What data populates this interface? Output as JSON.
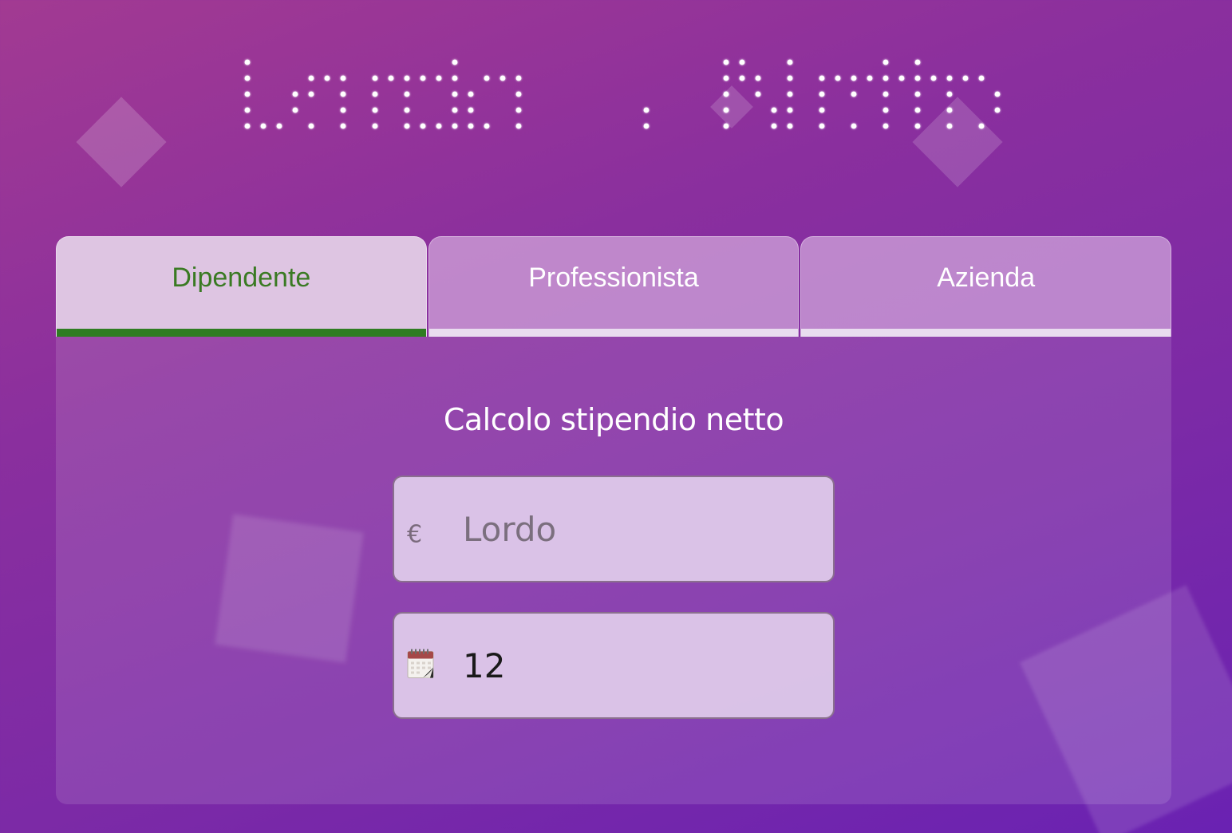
{
  "header": {
    "title": "Lordo → Netto"
  },
  "tabs": [
    {
      "label": "Dipendente",
      "active": true
    },
    {
      "label": "Professionista",
      "active": false
    },
    {
      "label": "Azienda",
      "active": false
    }
  ],
  "form": {
    "title": "Calcolo stipendio netto",
    "gross": {
      "icon": "euro-icon",
      "prefix": "€",
      "value": "",
      "placeholder": "Lordo"
    },
    "months": {
      "icon": "calendar-icon",
      "value": "12",
      "placeholder": ""
    }
  },
  "colors": {
    "accent_green": "#2f7c22",
    "active_tab_text": "#3a7a23",
    "background_start": "#a23a92",
    "background_end": "#6a22b2"
  }
}
